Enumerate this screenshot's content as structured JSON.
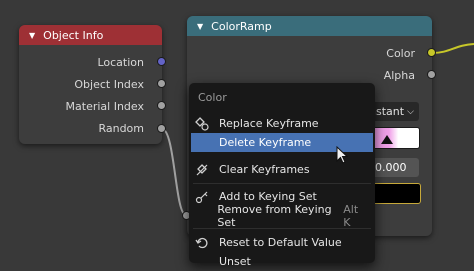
{
  "object_info": {
    "title": "Object Info",
    "outputs": [
      "Location",
      "Object Index",
      "Material Index",
      "Random"
    ]
  },
  "color_ramp": {
    "title": "ColorRamp",
    "outputs": [
      "Color",
      "Alpha"
    ],
    "interpolation_partial": "nstant",
    "position_value": "0.000"
  },
  "context_menu": {
    "title": "Color",
    "items": [
      {
        "label": "Replace Keyframe",
        "shortcut": ""
      },
      {
        "label": "Delete Keyframe",
        "shortcut": ""
      },
      {
        "label": "Clear Keyframes",
        "shortcut": ""
      },
      {
        "label": "Add to Keying Set",
        "shortcut": ""
      },
      {
        "label": "Remove from Keying Set",
        "shortcut": "Alt K"
      },
      {
        "label": "Reset to Default Value",
        "shortcut": ""
      },
      {
        "label": "Unset",
        "shortcut": ""
      }
    ]
  },
  "colors": {
    "node_bg": "#3d3d3d",
    "objinfo_header": "#9e3035",
    "colorramp_header": "#3a6d7b",
    "menu_bg": "#181818",
    "highlight": "#4772b3",
    "color_socket": "#c7c729",
    "vector_socket": "#6363c7",
    "float_socket": "#a1a1a1",
    "ramp_pink": "#f0a0e8"
  }
}
